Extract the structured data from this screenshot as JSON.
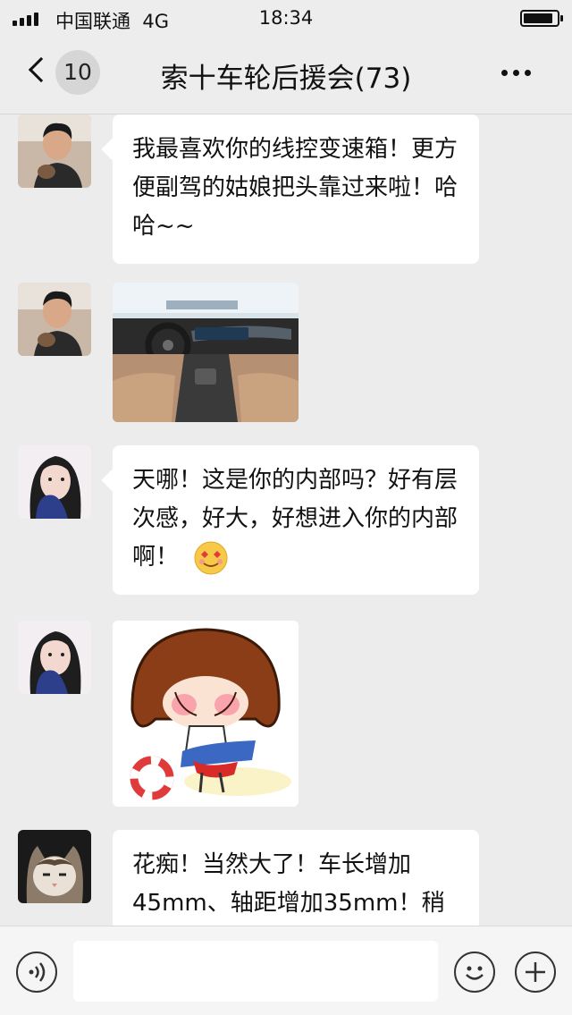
{
  "status_bar": {
    "carrier": "中国联通",
    "network": "4G",
    "time": "18:34",
    "battery_level": 0.9
  },
  "nav": {
    "unread_count": "10",
    "title": "索十车轮后援会(73)"
  },
  "messages": [
    {
      "sender_avatar": "man-avatar",
      "type": "text",
      "text": "我最喜欢你的线控变速箱！更方便副驾的姑娘把头靠过来啦！哈哈~~"
    },
    {
      "sender_avatar": "man-avatar",
      "type": "image",
      "image": "car-interior-photo"
    },
    {
      "sender_avatar": "woman-avatar",
      "type": "text",
      "text": "天哪！这是你的内部吗？好有层次感，好大，好想进入你的内部啊！",
      "emoji": "heart-eyes-emoji"
    },
    {
      "sender_avatar": "woman-avatar",
      "type": "sticker",
      "image": "shy-girl-sticker"
    },
    {
      "sender_avatar": "cat-avatar",
      "type": "text",
      "text": "花痴！当然大了！车长增加45mm、轴距增加35mm！稍"
    }
  ],
  "input": {
    "placeholder": "",
    "value": ""
  },
  "colors": {
    "background": "#ececec",
    "bubble": "#ffffff",
    "bar": "#ededed"
  }
}
